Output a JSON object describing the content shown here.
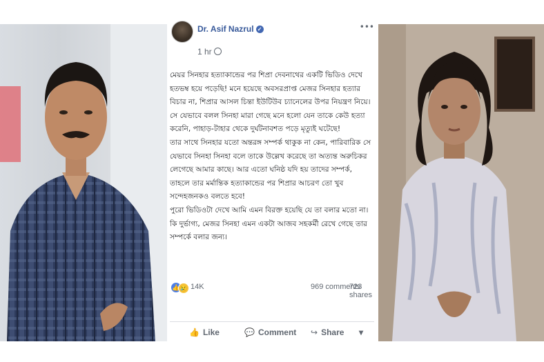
{
  "post": {
    "author": "Dr. Asif Nazrul",
    "time": "1 hr",
    "more": "•••",
    "paragraphs": [
      "মেয়র সিনহার হত্যাকান্ডের পর শিপ্রা দেবনাথের একটি ভিডিও দেখে হতভম্ব হয়ে পড়েছি! মনে হয়েছে অবসরপ্রাপ্ত মেজর সিনহার হত্যার বিচার না, শিপ্রার আসল চিন্তা ইউটিউব চ্যানেলের উপর নিয়ন্ত্রণ নিয়ে। সে যেভাবে বলল সিনহা মারা গেছে মনে হলো যেন তাকে কেউ হত্যা করেনি, পাহাড়-টাহার থেকে দুর্ঘটনাবশত পড়ে মৃত্যুই ঘটেছে!",
      "তার সাথে সিনহার যতো অন্তরঙ্গ সম্পর্ক থাকুক না কেন, পারিবারিক সে যেভাবে সিনহা সিনহা বলে তাকে উল্লেখ করেছে তা অত্যন্ত অরুচিকর লেগেছে আমার কাছে। আর এতো ঘনিষ্ঠ যদি হয় তাদের সম্পর্ক, তাহলে তার মর্মান্তিক হত্যাকান্ডের পর শিপ্রার আচরণ তো খুব সন্দেহজনকও বলতে হবে!",
      "পুরো ভিডিওটা দেখে আমি এমন বিরক্ত হয়েছি যে তা বলার মতো না। কি দুর্ভাগ্য, মেজর সিনহা এমন একটা আজব সহকর্মী রেখে গেছে তার সম্পর্কে বলার জন্য।"
    ],
    "reaction_count": "14K",
    "comments": "969 comments",
    "shares": "723 shares",
    "actions": {
      "like": "Like",
      "comment": "Comment",
      "share": "Share"
    }
  },
  "colors": {
    "author": "#365899",
    "meta": "#606770",
    "text": "#1c1e21",
    "like_blue": "#4d7fe6",
    "sad_yellow": "#f5c33b"
  },
  "icons": [
    "verified-icon",
    "globe-icon",
    "more-icon",
    "like-reaction-icon",
    "sad-reaction-icon",
    "like-icon",
    "comment-icon",
    "share-icon",
    "audience-dropdown-icon"
  ]
}
